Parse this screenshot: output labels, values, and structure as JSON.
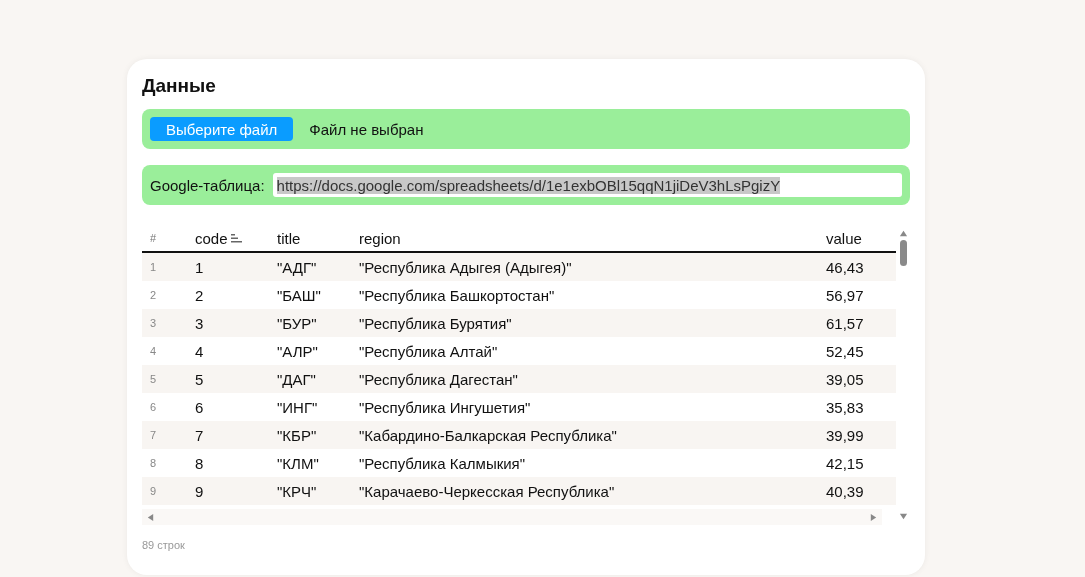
{
  "card": {
    "title": "Данные",
    "file_input": {
      "button": "Выберите файл",
      "status": "Файл не выбран"
    },
    "google_sheet": {
      "label": "Google-таблица:",
      "value": "https://docs.google.com/spreadsheets/d/1e1exbOBl15qqN1jiDeV3hLsPgizY",
      "selected": true
    },
    "table": {
      "columns": [
        {
          "label": "#",
          "sorted": false
        },
        {
          "label": "code",
          "sorted": true
        },
        {
          "label": "title",
          "sorted": false
        },
        {
          "label": "region",
          "sorted": false
        },
        {
          "label": "value",
          "sorted": false
        }
      ],
      "rows": [
        [
          "1",
          "1",
          "\"АДГ\"",
          "\"Республика Адыгея (Адыгея)\"",
          "46,43"
        ],
        [
          "2",
          "2",
          "\"БАШ\"",
          "\"Республика Башкортостан\"",
          "56,97"
        ],
        [
          "3",
          "3",
          "\"БУР\"",
          "\"Республика Бурятия\"",
          "61,57"
        ],
        [
          "4",
          "4",
          "\"АЛР\"",
          "\"Республика Алтай\"",
          "52,45"
        ],
        [
          "5",
          "5",
          "\"ДАГ\"",
          "\"Республика Дагестан\"",
          "39,05"
        ],
        [
          "6",
          "6",
          "\"ИНГ\"",
          "\"Республика Ингушетия\"",
          "35,83"
        ],
        [
          "7",
          "7",
          "\"КБР\"",
          "\"Кабардино-Балкарская Республика\"",
          "39,99"
        ],
        [
          "8",
          "8",
          "\"КЛМ\"",
          "\"Республика Калмыкия\"",
          "42,15"
        ],
        [
          "9",
          "9",
          "\"КРЧ\"",
          "\"Карачаево-Черкесская Республика\"",
          "40,39"
        ]
      ]
    },
    "footer": "89 строк"
  }
}
